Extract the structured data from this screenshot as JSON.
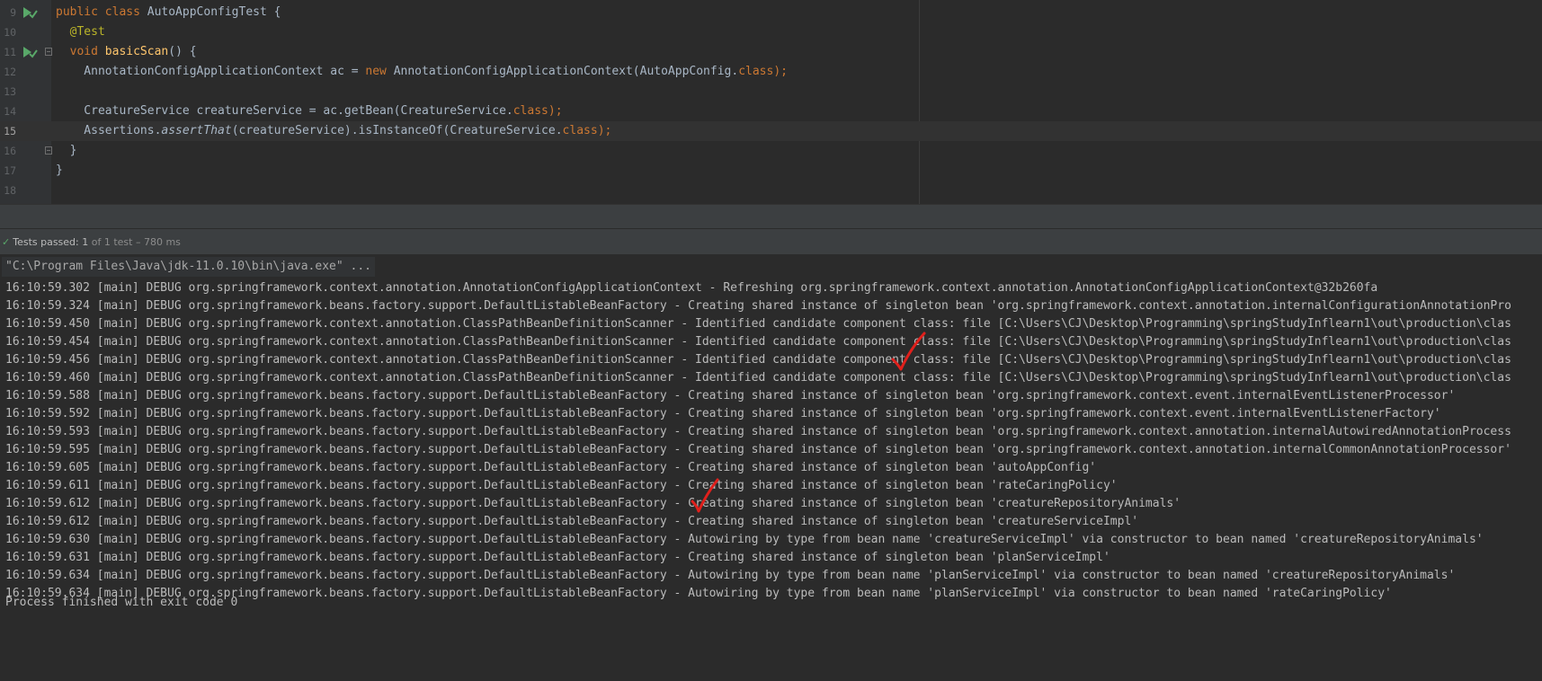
{
  "editor": {
    "lines": [
      {
        "num": "9",
        "segments": [
          {
            "t": "public class ",
            "c": "kw"
          },
          {
            "t": "AutoAppConfigTest {",
            "c": ""
          }
        ]
      },
      {
        "num": "10",
        "segments": [
          {
            "t": "  @Test",
            "c": "ann"
          }
        ]
      },
      {
        "num": "11",
        "segments": [
          {
            "t": "  ",
            "c": ""
          },
          {
            "t": "void ",
            "c": "kw"
          },
          {
            "t": "basicScan",
            "c": "fn"
          },
          {
            "t": "() {",
            "c": ""
          }
        ]
      },
      {
        "num": "12",
        "segments": [
          {
            "t": "    AnnotationConfigApplicationContext ac = ",
            "c": ""
          },
          {
            "t": "new ",
            "c": "kw"
          },
          {
            "t": "AnnotationConfigApplicationContext(AutoAppConfig.",
            "c": ""
          },
          {
            "t": "class",
            "c": "kw"
          },
          {
            "t": ");",
            "c": "kw"
          }
        ]
      },
      {
        "num": "13",
        "segments": []
      },
      {
        "num": "14",
        "segments": [
          {
            "t": "    CreatureService creatureService = ac.getBean(CreatureService.",
            "c": ""
          },
          {
            "t": "class",
            "c": "kw"
          },
          {
            "t": ");",
            "c": "kw"
          }
        ]
      },
      {
        "num": "15",
        "segments": [
          {
            "t": "    Assertions.",
            "c": ""
          },
          {
            "t": "assertThat",
            "c": "it"
          },
          {
            "t": "(creatureService).isInstanceOf(CreatureService.",
            "c": ""
          },
          {
            "t": "class",
            "c": "kw"
          },
          {
            "t": ");",
            "c": "kw"
          }
        ]
      },
      {
        "num": "16",
        "segments": [
          {
            "t": "  }",
            "c": ""
          }
        ]
      },
      {
        "num": "17",
        "segments": [
          {
            "t": "}",
            "c": ""
          }
        ]
      },
      {
        "num": "18",
        "segments": []
      }
    ]
  },
  "run_bar": {
    "status": "Tests passed: ",
    "passed": "1",
    "of_total": " of 1 test",
    "duration": " – 780 ms"
  },
  "console": {
    "command": "\"C:\\Program Files\\Java\\jdk-11.0.10\\bin\\java.exe\" ...",
    "logs": [
      "16:10:59.302 [main] DEBUG org.springframework.context.annotation.AnnotationConfigApplicationContext - Refreshing org.springframework.context.annotation.AnnotationConfigApplicationContext@32b260fa",
      "16:10:59.324 [main] DEBUG org.springframework.beans.factory.support.DefaultListableBeanFactory - Creating shared instance of singleton bean 'org.springframework.context.annotation.internalConfigurationAnnotationPro",
      "16:10:59.450 [main] DEBUG org.springframework.context.annotation.ClassPathBeanDefinitionScanner - Identified candidate component class: file [C:\\Users\\CJ\\Desktop\\Programming\\springStudyInflearn1\\out\\production\\clas",
      "16:10:59.454 [main] DEBUG org.springframework.context.annotation.ClassPathBeanDefinitionScanner - Identified candidate component class: file [C:\\Users\\CJ\\Desktop\\Programming\\springStudyInflearn1\\out\\production\\clas",
      "16:10:59.456 [main] DEBUG org.springframework.context.annotation.ClassPathBeanDefinitionScanner - Identified candidate component class: file [C:\\Users\\CJ\\Desktop\\Programming\\springStudyInflearn1\\out\\production\\clas",
      "16:10:59.460 [main] DEBUG org.springframework.context.annotation.ClassPathBeanDefinitionScanner - Identified candidate component class: file [C:\\Users\\CJ\\Desktop\\Programming\\springStudyInflearn1\\out\\production\\clas",
      "16:10:59.588 [main] DEBUG org.springframework.beans.factory.support.DefaultListableBeanFactory - Creating shared instance of singleton bean 'org.springframework.context.event.internalEventListenerProcessor'",
      "16:10:59.592 [main] DEBUG org.springframework.beans.factory.support.DefaultListableBeanFactory - Creating shared instance of singleton bean 'org.springframework.context.event.internalEventListenerFactory'",
      "16:10:59.593 [main] DEBUG org.springframework.beans.factory.support.DefaultListableBeanFactory - Creating shared instance of singleton bean 'org.springframework.context.annotation.internalAutowiredAnnotationProcess",
      "16:10:59.595 [main] DEBUG org.springframework.beans.factory.support.DefaultListableBeanFactory - Creating shared instance of singleton bean 'org.springframework.context.annotation.internalCommonAnnotationProcessor'",
      "16:10:59.605 [main] DEBUG org.springframework.beans.factory.support.DefaultListableBeanFactory - Creating shared instance of singleton bean 'autoAppConfig'",
      "16:10:59.611 [main] DEBUG org.springframework.beans.factory.support.DefaultListableBeanFactory - Creating shared instance of singleton bean 'rateCaringPolicy'",
      "16:10:59.612 [main] DEBUG org.springframework.beans.factory.support.DefaultListableBeanFactory - Creating shared instance of singleton bean 'creatureRepositoryAnimals'",
      "16:10:59.612 [main] DEBUG org.springframework.beans.factory.support.DefaultListableBeanFactory - Creating shared instance of singleton bean 'creatureServiceImpl'",
      "16:10:59.630 [main] DEBUG org.springframework.beans.factory.support.DefaultListableBeanFactory - Autowiring by type from bean name 'creatureServiceImpl' via constructor to bean named 'creatureRepositoryAnimals'",
      "16:10:59.631 [main] DEBUG org.springframework.beans.factory.support.DefaultListableBeanFactory - Creating shared instance of singleton bean 'planServiceImpl'",
      "16:10:59.634 [main] DEBUG org.springframework.beans.factory.support.DefaultListableBeanFactory - Autowiring by type from bean name 'planServiceImpl' via constructor to bean named 'creatureRepositoryAnimals'",
      "16:10:59.634 [main] DEBUG org.springframework.beans.factory.support.DefaultListableBeanFactory - Autowiring by type from bean name 'planServiceImpl' via constructor to bean named 'rateCaringPolicy'"
    ],
    "exit": "Process finished with exit code 0"
  },
  "colors": {
    "background": "#2b2b2b",
    "keyword": "#cc7832",
    "annotation": "#bbb529",
    "method": "#ffc66d",
    "text": "#a9b7c6",
    "console_text": "#bbbbbb",
    "pass_green": "#59a869",
    "handwritten_mark": "#e0201c"
  },
  "icons": [
    "run-test-gutter-icon",
    "fold-marker-icon",
    "check-icon",
    "handwritten-checkmark-icon"
  ]
}
